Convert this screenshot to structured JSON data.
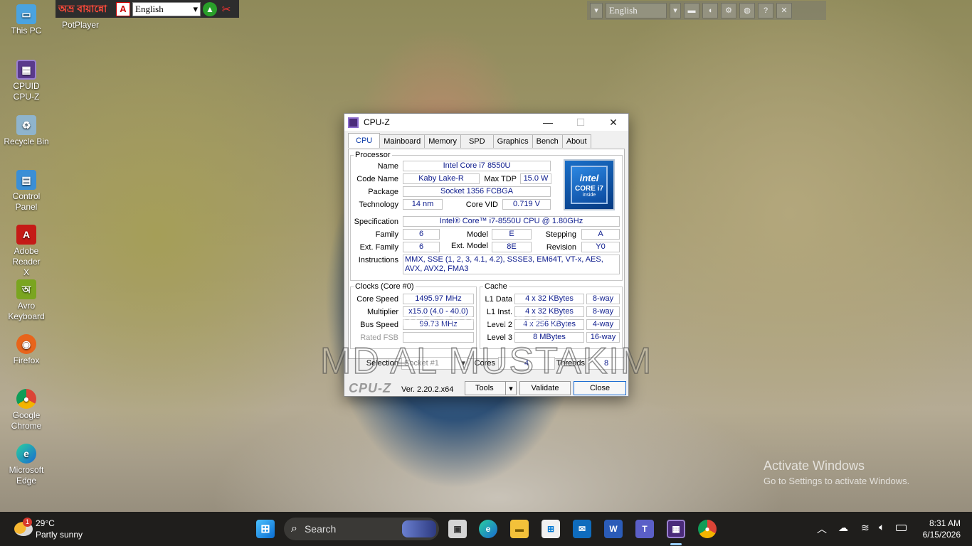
{
  "desktop_icons": [
    {
      "label": "This PC",
      "icon": "this-pc-icon",
      "color": "#4aa3e0"
    },
    {
      "label": "CPUID CPU-Z",
      "icon": "cpuz-icon",
      "color": "#5a3a8c"
    },
    {
      "label": "Recycle Bin",
      "icon": "recycle-bin-icon",
      "color": "#8fb4cc"
    },
    {
      "label": "Control Panel",
      "icon": "control-panel-icon",
      "color": "#3b8fd6"
    },
    {
      "label": "Adobe Reader X",
      "icon": "adobe-reader-icon",
      "color": "#c51b17"
    },
    {
      "label": "Avro Keyboard",
      "icon": "avro-keyboard-icon",
      "color": "#7aa520"
    },
    {
      "label": "Firefox",
      "icon": "firefox-icon",
      "color": "#e8641b"
    },
    {
      "label": "Google Chrome",
      "icon": "chrome-icon",
      "color": "#2f9e44"
    },
    {
      "label": "Microsoft Edge",
      "icon": "edge-icon",
      "color": "#1a8ad0"
    },
    {
      "label": "PotPlayer",
      "icon": "potplayer-icon",
      "color": "#e6b400"
    }
  ],
  "avro_bar": {
    "logo": "অভ্র বায়ান্নো",
    "language": "English"
  },
  "lang_bar": {
    "language": "English"
  },
  "cpuz": {
    "title": "CPU-Z",
    "tabs": [
      "CPU",
      "Mainboard",
      "Memory",
      "SPD",
      "Graphics",
      "Bench",
      "About"
    ],
    "processor": {
      "legend": "Processor",
      "name_label": "Name",
      "name": "Intel Core i7 8550U",
      "codename_label": "Code Name",
      "codename": "Kaby Lake-R",
      "maxtdp_label": "Max TDP",
      "maxtdp": "15.0 W",
      "package_label": "Package",
      "package": "Socket 1356 FCBGA",
      "technology_label": "Technology",
      "technology": "14 nm",
      "corevid_label": "Core VID",
      "corevid": "0.719 V",
      "spec_label": "Specification",
      "spec": "Intel® Core™ i7-8550U CPU @ 1.80GHz",
      "family_label": "Family",
      "family": "6",
      "model_label": "Model",
      "model": "E",
      "stepping_label": "Stepping",
      "stepping": "A",
      "extfamily_label": "Ext. Family",
      "extfamily": "6",
      "extmodel_label": "Ext. Model",
      "extmodel": "8E",
      "revision_label": "Revision",
      "revision": "Y0",
      "instructions_label": "Instructions",
      "instructions": "MMX, SSE (1, 2, 3, 4.1, 4.2), SSSE3, EM64T, VT-x, AES, AVX, AVX2, FMA3",
      "badge_brand": "intel",
      "badge_line": "CORE i7",
      "badge_sub": "inside"
    },
    "clocks": {
      "legend": "Clocks (Core #0)",
      "corespeed_label": "Core Speed",
      "corespeed": "1495.97 MHz",
      "multiplier_label": "Multiplier",
      "multiplier": "x15.0 (4.0 - 40.0)",
      "busspeed_label": "Bus Speed",
      "busspeed": "99.73 MHz",
      "ratedfsb_label": "Rated FSB",
      "ratedfsb": ""
    },
    "cache": {
      "legend": "Cache",
      "rows": [
        {
          "label": "L1 Data",
          "size": "4 x 32 KBytes",
          "way": "8-way"
        },
        {
          "label": "L1 Inst.",
          "size": "4 x 32 KBytes",
          "way": "8-way"
        },
        {
          "label": "Level 2",
          "size": "4 x 256 KBytes",
          "way": "4-way"
        },
        {
          "label": "Level 3",
          "size": "8 MBytes",
          "way": "16-way"
        }
      ]
    },
    "selection_label": "Selection",
    "selection": "Socket #1",
    "cores_label": "Cores",
    "cores": "4",
    "threads_label": "Threads",
    "threads": "8",
    "brand": "CPU-Z",
    "version": "Ver. 2.20.2.x64",
    "tools_label": "Tools",
    "validate_label": "Validate",
    "close_label": "Close"
  },
  "watermark": {
    "line1": "POSTED ON BIRDY",
    "line2": "MD AL MUSTAKIM"
  },
  "activate": {
    "title": "Activate Windows",
    "sub": "Go to Settings to activate Windows."
  },
  "taskbar": {
    "weather_temp": "29°C",
    "weather_desc": "Partly sunny",
    "weather_badge": "1",
    "search_placeholder": "Search",
    "time": "8:31 AM",
    "date": "6/15/2026"
  }
}
